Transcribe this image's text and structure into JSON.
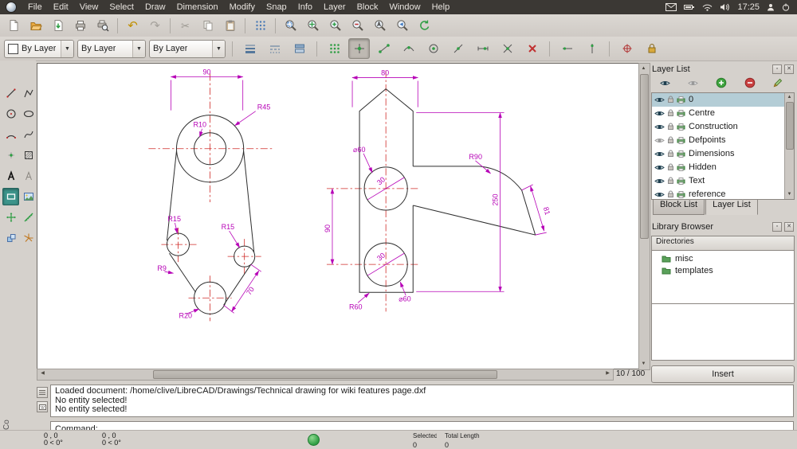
{
  "menubar": {
    "items": [
      "File",
      "Edit",
      "View",
      "Select",
      "Draw",
      "Dimension",
      "Modify",
      "Snap",
      "Info",
      "Layer",
      "Block",
      "Window",
      "Help"
    ],
    "clock": "17:25"
  },
  "toolbar": {
    "color_combo": "By Layer",
    "width_combo": "By Layer",
    "linetype_combo": "By Layer"
  },
  "layer_panel": {
    "title": "Layer List",
    "layers": [
      {
        "name": "0"
      },
      {
        "name": "Centre"
      },
      {
        "name": "Construction"
      },
      {
        "name": "Defpoints"
      },
      {
        "name": "Dimensions"
      },
      {
        "name": "Hidden"
      },
      {
        "name": "Text"
      },
      {
        "name": "reference"
      }
    ],
    "tabs": {
      "block": "Block List",
      "layer": "Layer List"
    }
  },
  "library_panel": {
    "title": "Library Browser",
    "directories_label": "Directories",
    "folders": [
      "misc",
      "templates"
    ],
    "insert_label": "Insert"
  },
  "canvas": {
    "page_indicator": "10 / 100"
  },
  "command_panel": {
    "history": [
      "Loaded document: /home/clive/LibreCAD/Drawings/Technical drawing for wiki features page.dxf",
      "No entity selected!",
      "No entity selected!"
    ],
    "prompt": "Command:",
    "dock_label": "Co"
  },
  "statusbar": {
    "abs_coord": "0 , 0",
    "abs_polar": "0 < 0°",
    "rel_coord": "0 , 0",
    "rel_polar": "0 < 0°",
    "selected_label": "Selected",
    "selected_value": "0",
    "total_length_label": "Total Length",
    "total_length_value": "0"
  },
  "drawing": {
    "left": {
      "width": "90",
      "r45": "R45",
      "r10": "R10",
      "r15_left": "R15",
      "r15_right": "R15",
      "r9": "R9",
      "r20": "R20",
      "len70": "70"
    },
    "right": {
      "width": "80",
      "dia60_top": "⌀60",
      "r90": "R90",
      "h250": "250",
      "len81": "81",
      "h90": "90",
      "ang30_top": "30",
      "ang30_bottom": "30",
      "r60": "R60",
      "dia60_bottom": "⌀60"
    }
  }
}
